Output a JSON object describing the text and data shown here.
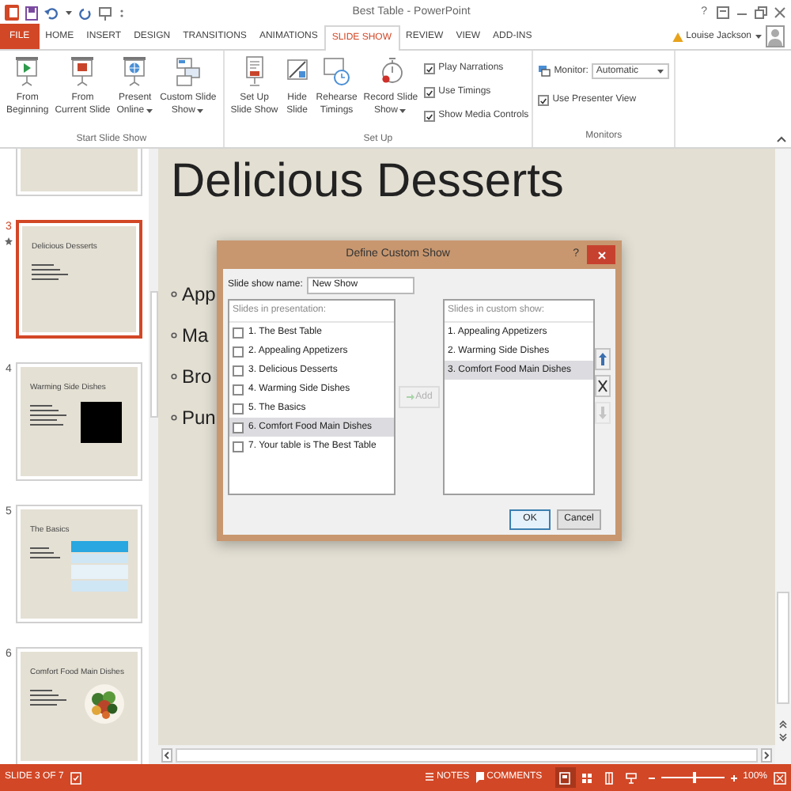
{
  "title_bar": {
    "title": "Best Table - PowerPoint",
    "help": "?"
  },
  "tabs": [
    {
      "label": "FILE",
      "kind": "file",
      "selected": false
    },
    {
      "label": "HOME",
      "kind": "tab",
      "selected": false
    },
    {
      "label": "INSERT",
      "kind": "tab",
      "selected": false
    },
    {
      "label": "DESIGN",
      "kind": "tab",
      "selected": false
    },
    {
      "label": "TRANSITIONS",
      "kind": "tab",
      "selected": false
    },
    {
      "label": "ANIMATIONS",
      "kind": "tab",
      "selected": false
    },
    {
      "label": "SLIDE SHOW",
      "kind": "tab",
      "selected": true
    },
    {
      "label": "REVIEW",
      "kind": "tab",
      "selected": false
    },
    {
      "label": "VIEW",
      "kind": "tab",
      "selected": false
    },
    {
      "label": "ADD-INS",
      "kind": "tab",
      "selected": false
    }
  ],
  "account": {
    "name": "Louise Jackson"
  },
  "ribbon": {
    "groups": [
      {
        "label": "Start Slide Show",
        "buttons": [
          {
            "lines": [
              "From",
              "Beginning"
            ],
            "dropdown": false
          },
          {
            "lines": [
              "From",
              "Current Slide"
            ],
            "dropdown": false
          },
          {
            "lines": [
              "Present",
              "Online"
            ],
            "dropdown": true
          },
          {
            "lines": [
              "Custom Slide",
              "Show"
            ],
            "dropdown": true
          }
        ]
      },
      {
        "label": "Set Up",
        "buttons": [
          {
            "lines": [
              "Set Up",
              "Slide Show"
            ],
            "dropdown": false
          },
          {
            "lines": [
              "Hide",
              "Slide"
            ],
            "dropdown": false
          },
          {
            "lines": [
              "Rehearse",
              "Timings"
            ],
            "dropdown": false
          },
          {
            "lines": [
              "Record Slide",
              "Show"
            ],
            "dropdown": true
          }
        ],
        "checkboxes": [
          {
            "label": "Play Narrations",
            "checked": true
          },
          {
            "label": "Use Timings",
            "checked": true
          },
          {
            "label": "Show Media Controls",
            "checked": true
          }
        ]
      },
      {
        "label": "Monitors",
        "monitor": {
          "label": "Monitor:",
          "value": "Automatic"
        },
        "checkboxes": [
          {
            "label": "Use Presenter View",
            "checked": true
          }
        ]
      }
    ]
  },
  "thumbnails": [
    {
      "kind": "blank",
      "selected": false
    },
    {
      "number": "3",
      "title": "Delicious Desserts",
      "kind": "bullets",
      "selected": true,
      "animated": true
    },
    {
      "number": "4",
      "title": "Warming Side Dishes",
      "selected": false,
      "animated": false
    },
    {
      "number": "5",
      "title": "The Basics",
      "kind": "table",
      "selected": false,
      "animated": false
    },
    {
      "number": "6",
      "title": "Comfort Food Main Dishes",
      "kind": "picture",
      "selected": false,
      "animated": false
    }
  ],
  "slide": {
    "title": "Delicious Desserts",
    "bullets": [
      "App",
      "Ma",
      "Bro",
      "Pun"
    ]
  },
  "dialog": {
    "title": "Define Custom Show",
    "help": "?",
    "name_label": "Slide show name:",
    "name_value": "New Show",
    "left_header": "Slides in presentation:",
    "left_items": [
      {
        "label": "1. The Best Table",
        "checked": false,
        "selected": false
      },
      {
        "label": "2. Appealing Appetizers",
        "checked": false,
        "selected": false
      },
      {
        "label": "3. Delicious Desserts",
        "checked": false,
        "selected": false
      },
      {
        "label": "4. Warming Side Dishes",
        "checked": false,
        "selected": false
      },
      {
        "label": "5. The Basics",
        "checked": false,
        "selected": false
      },
      {
        "label": "6. Comfort Food Main Dishes",
        "checked": false,
        "selected": true
      },
      {
        "label": "7. Your table is The Best Table",
        "checked": false,
        "selected": false
      }
    ],
    "add_button": {
      "label": "Add",
      "disabled": true
    },
    "right_header": "Slides in custom show:",
    "right_items": [
      {
        "label": "1. Appealing Appetizers",
        "selected": false
      },
      {
        "label": "2. Warming Side Dishes",
        "selected": false
      },
      {
        "label": "3. Comfort Food Main Dishes",
        "selected": true
      }
    ],
    "move_buttons": [
      {
        "kind": "up",
        "disabled": false
      },
      {
        "kind": "remove",
        "disabled": false
      },
      {
        "kind": "down",
        "disabled": true
      }
    ],
    "ok": "OK",
    "cancel": "Cancel"
  },
  "status_bar": {
    "slide_info": "SLIDE 3 OF 7",
    "notes": "NOTES",
    "comments": "COMMENTS",
    "views": [
      {
        "selected": true
      },
      {
        "selected": false
      },
      {
        "selected": false
      },
      {
        "selected": false
      }
    ],
    "zoom": {
      "label": "100%",
      "level": 0.5
    }
  }
}
